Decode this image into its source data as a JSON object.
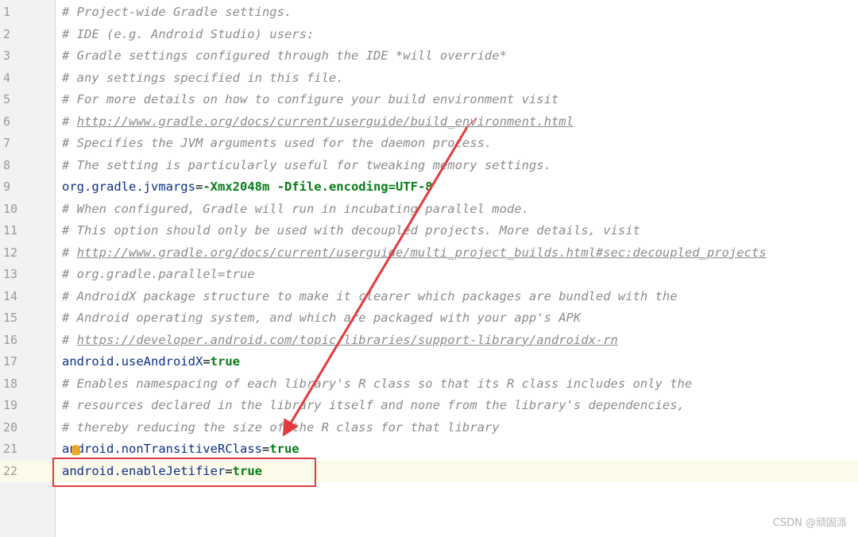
{
  "editor": {
    "lines": [
      {
        "num": "1",
        "type": "comment",
        "text": "# Project-wide Gradle settings."
      },
      {
        "num": "2",
        "type": "comment",
        "text": "# IDE (e.g. Android Studio) users:"
      },
      {
        "num": "3",
        "type": "comment",
        "text": "# Gradle settings configured through the IDE *will override*"
      },
      {
        "num": "4",
        "type": "comment",
        "text": "# any settings specified in this file."
      },
      {
        "num": "5",
        "type": "comment",
        "text": "# For more details on how to configure your build environment visit"
      },
      {
        "num": "6",
        "type": "comment-link",
        "prefix": "# ",
        "link": "http://www.gradle.org/docs/current/userguide/build_environment.html"
      },
      {
        "num": "7",
        "type": "comment",
        "text": "# Specifies the JVM arguments used for the daemon process."
      },
      {
        "num": "8",
        "type": "comment",
        "text": "# The setting is particularly useful for tweaking memory settings."
      },
      {
        "num": "9",
        "type": "property",
        "key": "org.gradle.jvmargs",
        "value": "-Xmx2048m -Dfile.encoding=UTF-8"
      },
      {
        "num": "10",
        "type": "comment",
        "text": "# When configured, Gradle will run in incubating parallel mode."
      },
      {
        "num": "11",
        "type": "comment",
        "text": "# This option should only be used with decoupled projects. More details, visit"
      },
      {
        "num": "12",
        "type": "comment-link",
        "prefix": "# ",
        "link": "http://www.gradle.org/docs/current/userguide/multi_project_builds.html#sec:decoupled_projects"
      },
      {
        "num": "13",
        "type": "comment",
        "text": "# org.gradle.parallel=true"
      },
      {
        "num": "14",
        "type": "comment",
        "text": "# AndroidX package structure to make it clearer which packages are bundled with the"
      },
      {
        "num": "15",
        "type": "comment",
        "text": "# Android operating system, and which are packaged with your app's APK"
      },
      {
        "num": "16",
        "type": "comment-link",
        "prefix": "# ",
        "link": "https://developer.android.com/topic/libraries/support-library/androidx-rn"
      },
      {
        "num": "17",
        "type": "property",
        "key": "android.useAndroidX",
        "value": "true"
      },
      {
        "num": "18",
        "type": "comment",
        "text": "# Enables namespacing of each library's R class so that its R class includes only the"
      },
      {
        "num": "19",
        "type": "comment",
        "text": "# resources declared in the library itself and none from the library's dependencies,"
      },
      {
        "num": "20",
        "type": "comment",
        "text": "# thereby reducing the size of the R class for that library"
      },
      {
        "num": "21",
        "type": "property",
        "key": "android.nonTransitiveRClass",
        "value": "true"
      },
      {
        "num": "22",
        "type": "property",
        "key": "android.enableJetifier",
        "value": "true",
        "current": true
      }
    ]
  },
  "annotation": {
    "color": "#e23b3b"
  },
  "watermark": "CSDN @顽固派"
}
